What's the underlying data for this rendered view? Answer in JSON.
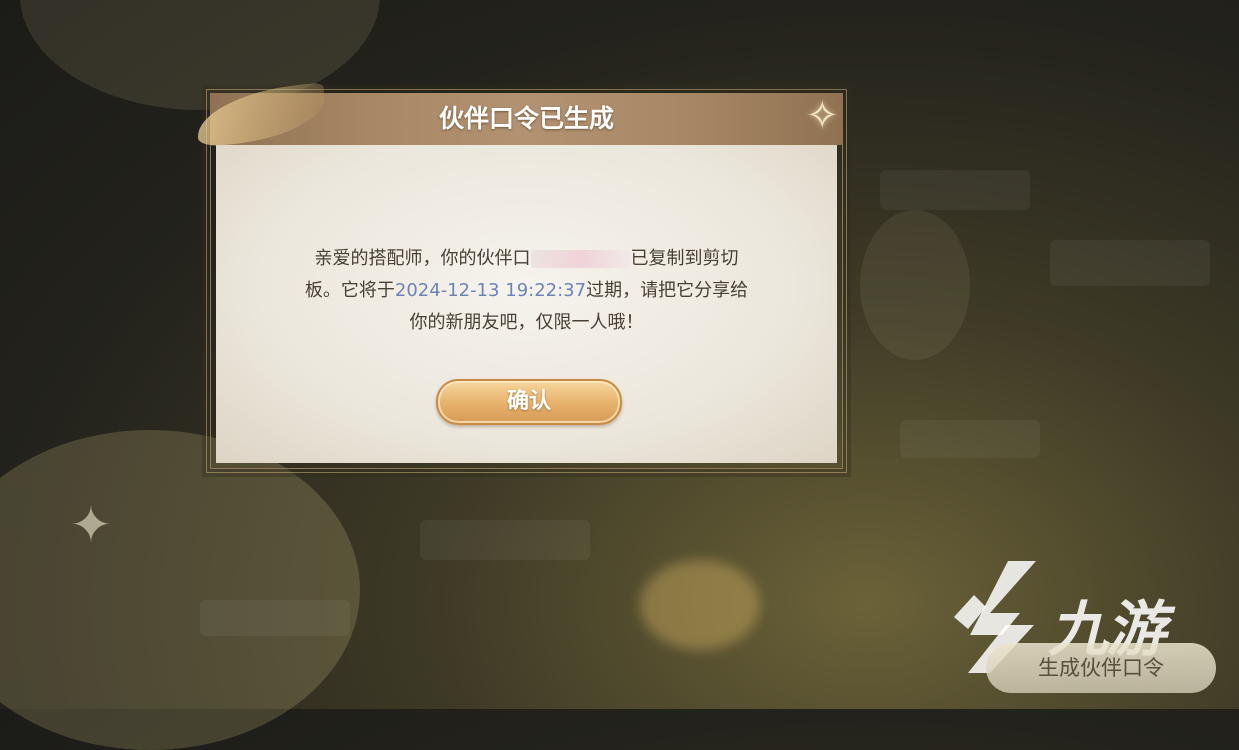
{
  "dialog": {
    "title": "伙伴口令已生成",
    "message": {
      "part1": "亲爱的搭配师，你的伙伴口",
      "part2": "已复制到剪切",
      "part3": "板。它将于",
      "expiry_date": "2024-12-13 19:22:37",
      "part4": "过期，请把它分享给",
      "part5": "你的新朋友吧，仅限一人哦！"
    },
    "confirm_label": "确认"
  },
  "watermark": {
    "text": "九游"
  },
  "generate_button_label": "生成伙伴口令",
  "colors": {
    "header": "#a88764",
    "date_highlight": "#6b84b8",
    "button": "#e8b46e",
    "body_text": "#4a4035"
  }
}
